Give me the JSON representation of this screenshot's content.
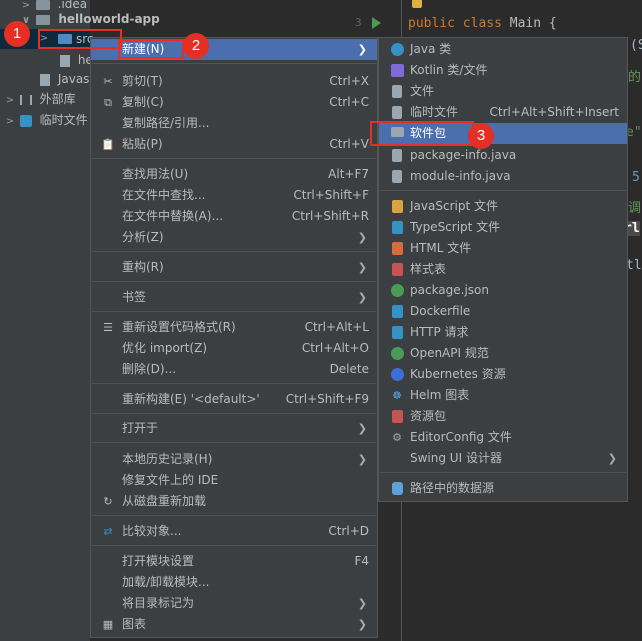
{
  "project_tree": {
    "rows": [
      {
        "label": ".idea",
        "arrow": ">"
      },
      {
        "label": "helloworld-app",
        "arrow": "∨"
      },
      {
        "label": "src",
        "arrow": ">"
      },
      {
        "label": "he",
        "arrow": ""
      },
      {
        "label": "Javas",
        "arrow": ""
      },
      {
        "label": "外部库",
        "arrow": ">"
      },
      {
        "label": "临时文件",
        "arrow": ">"
      }
    ]
  },
  "editor": {
    "line_number": "3",
    "code_prefix": "public class",
    "code_rest": " Main {",
    "fragments": [
      "(St",
      "的",
      "e\"",
      "5",
      "调",
      "rl",
      "tl"
    ]
  },
  "context_menu": {
    "items": [
      {
        "label": "新建(N)",
        "shortcut": "",
        "submenu": true,
        "icon": ""
      },
      {
        "label": "剪切(T)",
        "shortcut": "Ctrl+X",
        "submenu": false,
        "icon": "scissors-icon"
      },
      {
        "label": "复制(C)",
        "shortcut": "Ctrl+C",
        "submenu": false,
        "icon": "copy-icon"
      },
      {
        "label": "复制路径/引用...",
        "shortcut": "",
        "submenu": false,
        "icon": ""
      },
      {
        "label": "粘贴(P)",
        "shortcut": "Ctrl+V",
        "submenu": false,
        "icon": "paste-icon"
      },
      {
        "label": "查找用法(U)",
        "shortcut": "Alt+F7",
        "submenu": false,
        "icon": ""
      },
      {
        "label": "在文件中查找...",
        "shortcut": "Ctrl+Shift+F",
        "submenu": false,
        "icon": ""
      },
      {
        "label": "在文件中替换(A)...",
        "shortcut": "Ctrl+Shift+R",
        "submenu": false,
        "icon": ""
      },
      {
        "label": "分析(Z)",
        "shortcut": "",
        "submenu": true,
        "icon": ""
      },
      {
        "label": "重构(R)",
        "shortcut": "",
        "submenu": true,
        "icon": ""
      },
      {
        "label": "书签",
        "shortcut": "",
        "submenu": true,
        "icon": ""
      },
      {
        "label": "重新设置代码格式(R)",
        "shortcut": "Ctrl+Alt+L",
        "submenu": false,
        "icon": "format-icon"
      },
      {
        "label": "优化 import(Z)",
        "shortcut": "Ctrl+Alt+O",
        "submenu": false,
        "icon": ""
      },
      {
        "label": "删除(D)...",
        "shortcut": "Delete",
        "submenu": false,
        "icon": ""
      },
      {
        "label": "重新构建(E) '<default>'",
        "shortcut": "Ctrl+Shift+F9",
        "submenu": false,
        "icon": ""
      },
      {
        "label": "打开于",
        "shortcut": "",
        "submenu": true,
        "icon": ""
      },
      {
        "label": "本地历史记录(H)",
        "shortcut": "",
        "submenu": true,
        "icon": ""
      },
      {
        "label": "修复文件上的 IDE",
        "shortcut": "",
        "submenu": false,
        "icon": ""
      },
      {
        "label": "从磁盘重新加载",
        "shortcut": "",
        "submenu": false,
        "icon": "reload-icon"
      },
      {
        "label": "比较对象...",
        "shortcut": "Ctrl+D",
        "submenu": false,
        "icon": "compare-icon"
      },
      {
        "label": "打开模块设置",
        "shortcut": "F4",
        "submenu": false,
        "icon": ""
      },
      {
        "label": "加载/卸载模块...",
        "shortcut": "",
        "submenu": false,
        "icon": ""
      },
      {
        "label": "将目录标记为",
        "shortcut": "",
        "submenu": true,
        "icon": ""
      },
      {
        "label": "图表",
        "shortcut": "",
        "submenu": true,
        "icon": "diagram-icon"
      }
    ]
  },
  "new_submenu": {
    "items": [
      {
        "label": "Java 类",
        "shortcut": "",
        "submenu": false,
        "icon": "java-class-icon",
        "color": "#3592c4"
      },
      {
        "label": "Kotlin 类/文件",
        "shortcut": "",
        "submenu": false,
        "icon": "kotlin-icon",
        "color": "#7f6bd8"
      },
      {
        "label": "文件",
        "shortcut": "",
        "submenu": false,
        "icon": "file-icon",
        "color": "#9aa7b0"
      },
      {
        "label": "临时文件",
        "shortcut": "Ctrl+Alt+Shift+Insert",
        "submenu": false,
        "icon": "scratch-file-icon",
        "color": "#9aa7b0"
      },
      {
        "label": "软件包",
        "shortcut": "",
        "submenu": false,
        "icon": "package-icon",
        "color": "#9aa7b0"
      },
      {
        "label": "package-info.java",
        "shortcut": "",
        "submenu": false,
        "icon": "java-file-icon",
        "color": "#9aa7b0"
      },
      {
        "label": "module-info.java",
        "shortcut": "",
        "submenu": false,
        "icon": "java-file-icon",
        "color": "#9aa7b0"
      },
      {
        "label": "JavaScript 文件",
        "shortcut": "",
        "submenu": false,
        "icon": "js-file-icon",
        "color": "#d9a343"
      },
      {
        "label": "TypeScript 文件",
        "shortcut": "",
        "submenu": false,
        "icon": "ts-file-icon",
        "color": "#3592c4"
      },
      {
        "label": "HTML 文件",
        "shortcut": "",
        "submenu": false,
        "icon": "html-file-icon",
        "color": "#d96a3a"
      },
      {
        "label": "样式表",
        "shortcut": "",
        "submenu": false,
        "icon": "css-file-icon",
        "color": "#c75450"
      },
      {
        "label": "package.json",
        "shortcut": "",
        "submenu": false,
        "icon": "npm-icon",
        "color": "#499c54"
      },
      {
        "label": "Dockerfile",
        "shortcut": "",
        "submenu": false,
        "icon": "docker-icon",
        "color": "#3592c4"
      },
      {
        "label": "HTTP 请求",
        "shortcut": "",
        "submenu": false,
        "icon": "http-request-icon",
        "color": "#3592c4"
      },
      {
        "label": "OpenAPI 规范",
        "shortcut": "",
        "submenu": false,
        "icon": "openapi-icon",
        "color": "#499c54"
      },
      {
        "label": "Kubernetes 资源",
        "shortcut": "",
        "submenu": false,
        "icon": "kubernetes-icon",
        "color": "#3e6fd8"
      },
      {
        "label": "Helm 图表",
        "shortcut": "",
        "submenu": false,
        "icon": "helm-icon",
        "color": "#5fa0d8"
      },
      {
        "label": "资源包",
        "shortcut": "",
        "submenu": false,
        "icon": "resource-bundle-icon",
        "color": "#c75450"
      },
      {
        "label": "EditorConfig 文件",
        "shortcut": "",
        "submenu": false,
        "icon": "gear-icon",
        "color": "#9aa7b0"
      },
      {
        "label": "Swing UI 设计器",
        "shortcut": "",
        "submenu": true,
        "icon": "",
        "color": ""
      },
      {
        "label": "路径中的数据源",
        "shortcut": "",
        "submenu": false,
        "icon": "database-icon",
        "color": "#5fa0d8"
      }
    ]
  },
  "annotations": [
    "1",
    "2",
    "3"
  ],
  "colors": {
    "selection": "#4b6eaf",
    "menu_bg": "#3c3f41",
    "annotation_red": "#e32f24"
  }
}
